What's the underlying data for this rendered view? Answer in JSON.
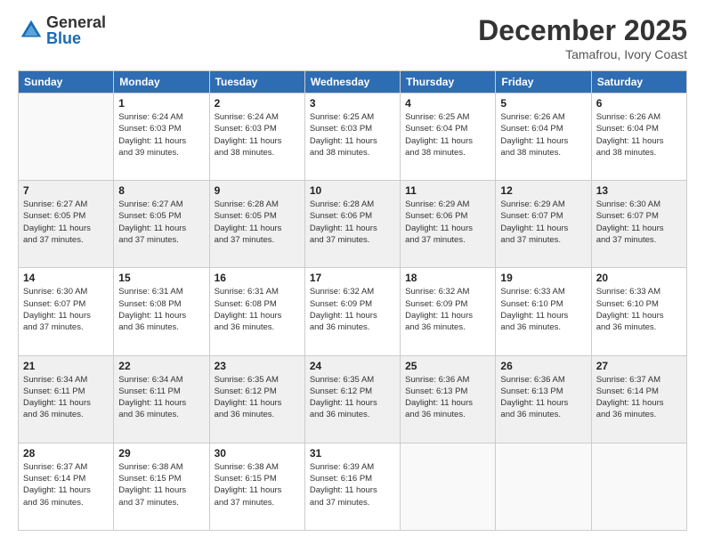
{
  "logo": {
    "general": "General",
    "blue": "Blue"
  },
  "header": {
    "month": "December 2025",
    "location": "Tamafrou, Ivory Coast"
  },
  "days_of_week": [
    "Sunday",
    "Monday",
    "Tuesday",
    "Wednesday",
    "Thursday",
    "Friday",
    "Saturday"
  ],
  "weeks": [
    [
      {
        "day": "",
        "info": ""
      },
      {
        "day": "1",
        "info": "Sunrise: 6:24 AM\nSunset: 6:03 PM\nDaylight: 11 hours\nand 39 minutes."
      },
      {
        "day": "2",
        "info": "Sunrise: 6:24 AM\nSunset: 6:03 PM\nDaylight: 11 hours\nand 38 minutes."
      },
      {
        "day": "3",
        "info": "Sunrise: 6:25 AM\nSunset: 6:03 PM\nDaylight: 11 hours\nand 38 minutes."
      },
      {
        "day": "4",
        "info": "Sunrise: 6:25 AM\nSunset: 6:04 PM\nDaylight: 11 hours\nand 38 minutes."
      },
      {
        "day": "5",
        "info": "Sunrise: 6:26 AM\nSunset: 6:04 PM\nDaylight: 11 hours\nand 38 minutes."
      },
      {
        "day": "6",
        "info": "Sunrise: 6:26 AM\nSunset: 6:04 PM\nDaylight: 11 hours\nand 38 minutes."
      }
    ],
    [
      {
        "day": "7",
        "info": "Sunrise: 6:27 AM\nSunset: 6:05 PM\nDaylight: 11 hours\nand 37 minutes."
      },
      {
        "day": "8",
        "info": "Sunrise: 6:27 AM\nSunset: 6:05 PM\nDaylight: 11 hours\nand 37 minutes."
      },
      {
        "day": "9",
        "info": "Sunrise: 6:28 AM\nSunset: 6:05 PM\nDaylight: 11 hours\nand 37 minutes."
      },
      {
        "day": "10",
        "info": "Sunrise: 6:28 AM\nSunset: 6:06 PM\nDaylight: 11 hours\nand 37 minutes."
      },
      {
        "day": "11",
        "info": "Sunrise: 6:29 AM\nSunset: 6:06 PM\nDaylight: 11 hours\nand 37 minutes."
      },
      {
        "day": "12",
        "info": "Sunrise: 6:29 AM\nSunset: 6:07 PM\nDaylight: 11 hours\nand 37 minutes."
      },
      {
        "day": "13",
        "info": "Sunrise: 6:30 AM\nSunset: 6:07 PM\nDaylight: 11 hours\nand 37 minutes."
      }
    ],
    [
      {
        "day": "14",
        "info": "Sunrise: 6:30 AM\nSunset: 6:07 PM\nDaylight: 11 hours\nand 37 minutes."
      },
      {
        "day": "15",
        "info": "Sunrise: 6:31 AM\nSunset: 6:08 PM\nDaylight: 11 hours\nand 36 minutes."
      },
      {
        "day": "16",
        "info": "Sunrise: 6:31 AM\nSunset: 6:08 PM\nDaylight: 11 hours\nand 36 minutes."
      },
      {
        "day": "17",
        "info": "Sunrise: 6:32 AM\nSunset: 6:09 PM\nDaylight: 11 hours\nand 36 minutes."
      },
      {
        "day": "18",
        "info": "Sunrise: 6:32 AM\nSunset: 6:09 PM\nDaylight: 11 hours\nand 36 minutes."
      },
      {
        "day": "19",
        "info": "Sunrise: 6:33 AM\nSunset: 6:10 PM\nDaylight: 11 hours\nand 36 minutes."
      },
      {
        "day": "20",
        "info": "Sunrise: 6:33 AM\nSunset: 6:10 PM\nDaylight: 11 hours\nand 36 minutes."
      }
    ],
    [
      {
        "day": "21",
        "info": "Sunrise: 6:34 AM\nSunset: 6:11 PM\nDaylight: 11 hours\nand 36 minutes."
      },
      {
        "day": "22",
        "info": "Sunrise: 6:34 AM\nSunset: 6:11 PM\nDaylight: 11 hours\nand 36 minutes."
      },
      {
        "day": "23",
        "info": "Sunrise: 6:35 AM\nSunset: 6:12 PM\nDaylight: 11 hours\nand 36 minutes."
      },
      {
        "day": "24",
        "info": "Sunrise: 6:35 AM\nSunset: 6:12 PM\nDaylight: 11 hours\nand 36 minutes."
      },
      {
        "day": "25",
        "info": "Sunrise: 6:36 AM\nSunset: 6:13 PM\nDaylight: 11 hours\nand 36 minutes."
      },
      {
        "day": "26",
        "info": "Sunrise: 6:36 AM\nSunset: 6:13 PM\nDaylight: 11 hours\nand 36 minutes."
      },
      {
        "day": "27",
        "info": "Sunrise: 6:37 AM\nSunset: 6:14 PM\nDaylight: 11 hours\nand 36 minutes."
      }
    ],
    [
      {
        "day": "28",
        "info": "Sunrise: 6:37 AM\nSunset: 6:14 PM\nDaylight: 11 hours\nand 36 minutes."
      },
      {
        "day": "29",
        "info": "Sunrise: 6:38 AM\nSunset: 6:15 PM\nDaylight: 11 hours\nand 37 minutes."
      },
      {
        "day": "30",
        "info": "Sunrise: 6:38 AM\nSunset: 6:15 PM\nDaylight: 11 hours\nand 37 minutes."
      },
      {
        "day": "31",
        "info": "Sunrise: 6:39 AM\nSunset: 6:16 PM\nDaylight: 11 hours\nand 37 minutes."
      },
      {
        "day": "",
        "info": ""
      },
      {
        "day": "",
        "info": ""
      },
      {
        "day": "",
        "info": ""
      }
    ]
  ]
}
